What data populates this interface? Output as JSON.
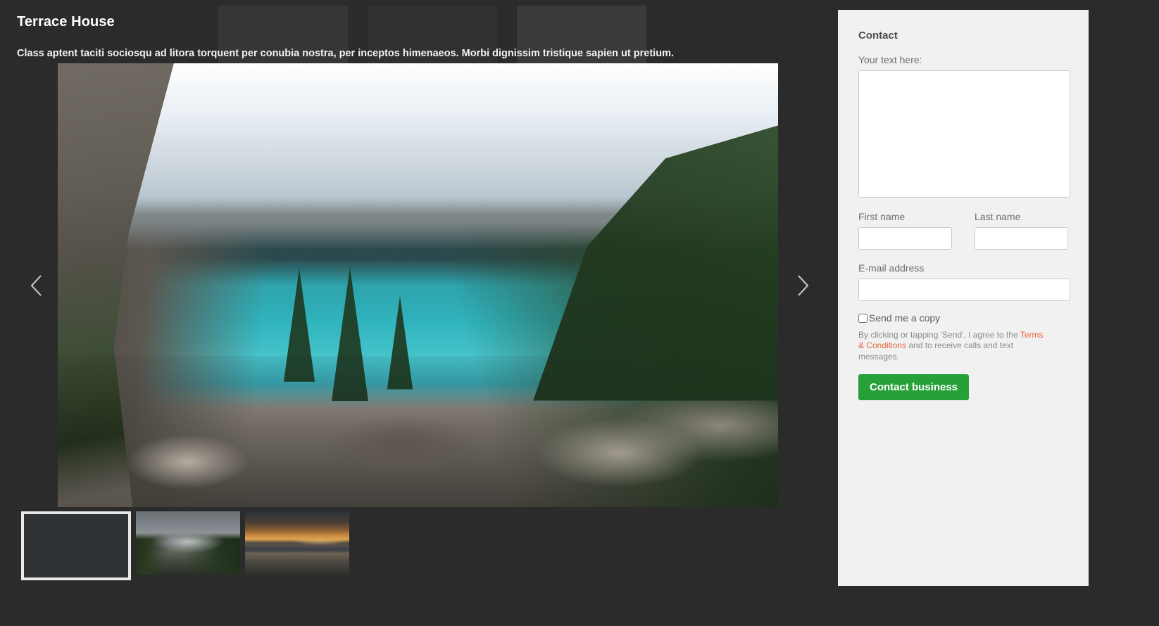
{
  "theme": {
    "page_background": "#2b2b2b",
    "panel_background": "#f1f1f1",
    "accent_link": "#e8663a",
    "submit_green": "#28a03a",
    "title_color": "#ffffff"
  },
  "header": {
    "title": "Terrace House",
    "description": "Class aptent taciti sociosqu ad litora torquent per conubia nostra, per inceptos himenaeos. Morbi dignissim tristique sapien ut pretium."
  },
  "carousel": {
    "prev_label": "‹",
    "next_label": "›",
    "prev_icon": "chevron-left-icon",
    "next_icon": "chevron-right-icon",
    "active_index": 0,
    "slides": [
      {
        "alt": "Turquoise glacial lake with snowy mountain peaks and rocky foreground",
        "art": "lake"
      },
      {
        "alt": "Foggy mountain valley with dark conifer forest",
        "art": "fog"
      },
      {
        "alt": "Golden sunset over a calm lake with a beached canoe",
        "art": "sunset"
      }
    ]
  },
  "contact": {
    "title": "Contact",
    "message_label": "Your text here:",
    "message_value": "",
    "message_placeholder": "",
    "first_name_label": "First name",
    "first_name_value": "",
    "first_name_placeholder": "",
    "last_name_label": "Last name",
    "last_name_value": "",
    "last_name_placeholder": "",
    "email_label": "E-mail address",
    "email_value": "",
    "email_placeholder": "",
    "copy_checkbox_label": "Send me a copy",
    "copy_checkbox_checked": false,
    "disclaimer_before": "By clicking or tapping 'Send', I agree to the ",
    "disclaimer_link": "Terms & Conditions",
    "disclaimer_after": " and to receive calls and text messages.",
    "submit_label": "Contact business"
  }
}
